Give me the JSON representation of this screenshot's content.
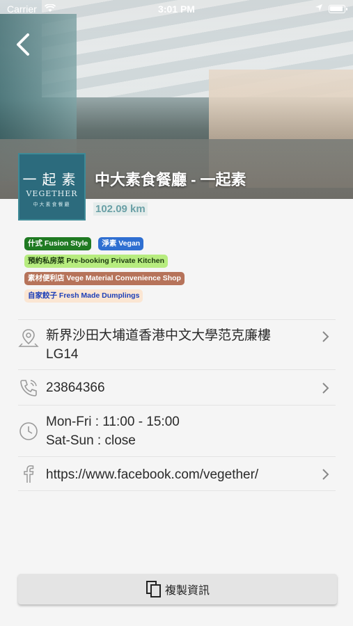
{
  "status_bar": {
    "carrier": "Carrier",
    "time": "3:01 PM"
  },
  "restaurant": {
    "name": "中大素食餐廳 - 一起素",
    "distance": "102.09 km",
    "logo": {
      "zh": "一起素",
      "en": "VEGETHER",
      "sub": "中大素食餐廳"
    }
  },
  "tags": [
    {
      "label": "什式 Fusion Style",
      "color": "#1f7a22"
    },
    {
      "label": "淨素 Vegan",
      "color": "#2f6fd1"
    },
    {
      "label": "預約私房菜 Pre-booking Private Kitchen",
      "color": "#b7ec7f"
    },
    {
      "label": "素材便利店 Vege Material Convenience Shop",
      "color": "#b6735a"
    },
    {
      "label": "自家餃子 Fresh Made Dumplings",
      "color": "#fbe6d3"
    }
  ],
  "info": {
    "address_line1": "新界沙田大埔道香港中文大學范克廉樓",
    "address_line2": "LG14",
    "phone": "23864366",
    "hours_line1": "Mon-Fri : 11:00 - 15:00",
    "hours_line2": "Sat-Sun : close",
    "facebook": "https://www.facebook.com/vegether/"
  },
  "copy_button": {
    "label": "複製資訊"
  },
  "icons": [
    "back-icon",
    "location-pin-icon",
    "phone-icon",
    "clock-icon",
    "facebook-icon",
    "chevron-right-icon",
    "copy-icon",
    "wifi-icon",
    "battery-icon"
  ]
}
